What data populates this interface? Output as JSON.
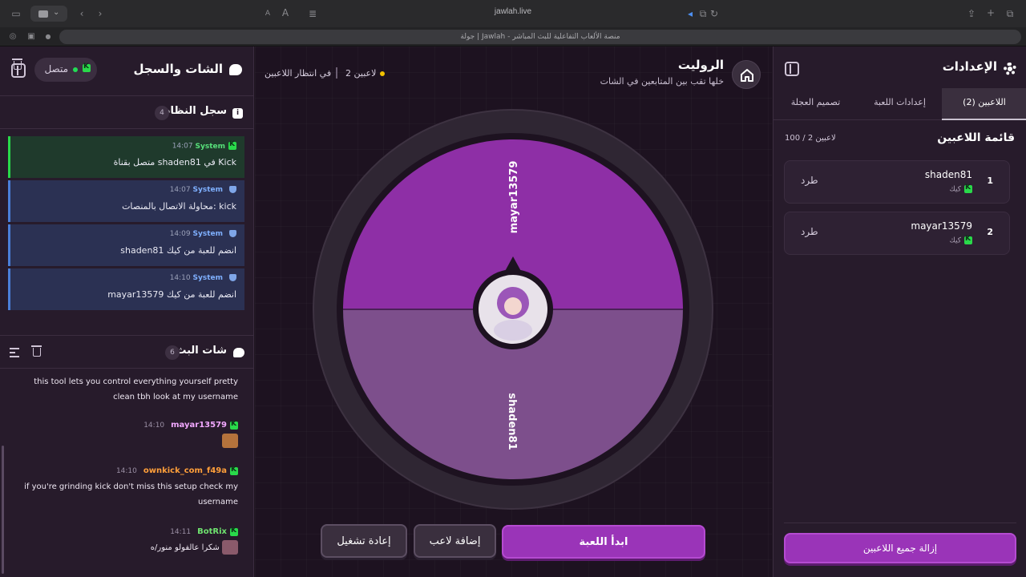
{
  "browser": {
    "url": "jawlah.live",
    "tab_title": "جولة | Jawlah - منصة الألعاب التفاعلية للبث المباشر"
  },
  "left_panel": {
    "title": "الشات والسجل",
    "status": "متصل",
    "system_log": {
      "title": "سجل النظام",
      "count": "4",
      "messages": [
        {
          "user": "System",
          "time": "14:07",
          "text": "متصل بقناة shaden81 في Kick",
          "platform": "kick"
        },
        {
          "user": "System",
          "time": "14:07",
          "text": "محاولة الاتصال بالمنصات: kick",
          "platform": "system"
        },
        {
          "user": "System",
          "time": "14:09",
          "text": "shaden81 انضم للعبة من كيك",
          "platform": "system"
        },
        {
          "user": "System",
          "time": "14:10",
          "text": "mayar13579 انضم للعبة من كيك",
          "platform": "system"
        }
      ]
    },
    "stream_chat": {
      "title": "شات البث",
      "count": "6",
      "messages": [
        {
          "user": "",
          "time": "",
          "text": "this tool lets you control everything yourself pretty clean tbh look at my username"
        },
        {
          "user": "mayar13579",
          "time": "14:10",
          "text": "",
          "user_color": "#f2a9ff",
          "emote": "#b5733c"
        },
        {
          "user": "ownkick_com_f49a",
          "time": "14:10",
          "text": "if you're grinding kick don't miss this setup check my username",
          "user_color": "#ff9f3a"
        },
        {
          "user": "BotRix",
          "time": "14:11",
          "text": "شكرا عالفولو منور/ه",
          "user_color": "#6fe36f",
          "emote": "#8a5a6b"
        }
      ]
    }
  },
  "center": {
    "title": "الروليت",
    "subtitle": "خلها تقب بين المتابعين في الشات",
    "player_count": "2 لاعبين",
    "waiting": "في انتظار اللاعبين",
    "wheel": {
      "segments": [
        {
          "label": "mayar13579",
          "color": "#8e2fa6"
        },
        {
          "label": "shaden81",
          "color": "#7d4f8c"
        }
      ]
    },
    "buttons": {
      "start": "ابدأ اللعبة",
      "add_player": "إضافة لاعب",
      "reset": "إعادة تشغيل"
    }
  },
  "right_panel": {
    "title": "الإعدادات",
    "tabs": [
      {
        "label": "اللاعبين (2)",
        "active": true
      },
      {
        "label": "إعدادات اللعبة",
        "active": false
      },
      {
        "label": "تصميم العجلة",
        "active": false
      }
    ],
    "list_title": "قائمة اللاعبين",
    "list_count": "100 / 2 لاعبين",
    "players": [
      {
        "num": "1",
        "name": "shaden81",
        "platform": "كيك",
        "kick_label": "طرد"
      },
      {
        "num": "2",
        "name": "mayar13579",
        "platform": "كيك",
        "kick_label": "طرد"
      }
    ],
    "remove_all": "إزالة جميع اللاعبين"
  },
  "colors": {
    "accent": "#9a34b8",
    "kick_green": "#29d94a",
    "background": "#1e1420"
  }
}
